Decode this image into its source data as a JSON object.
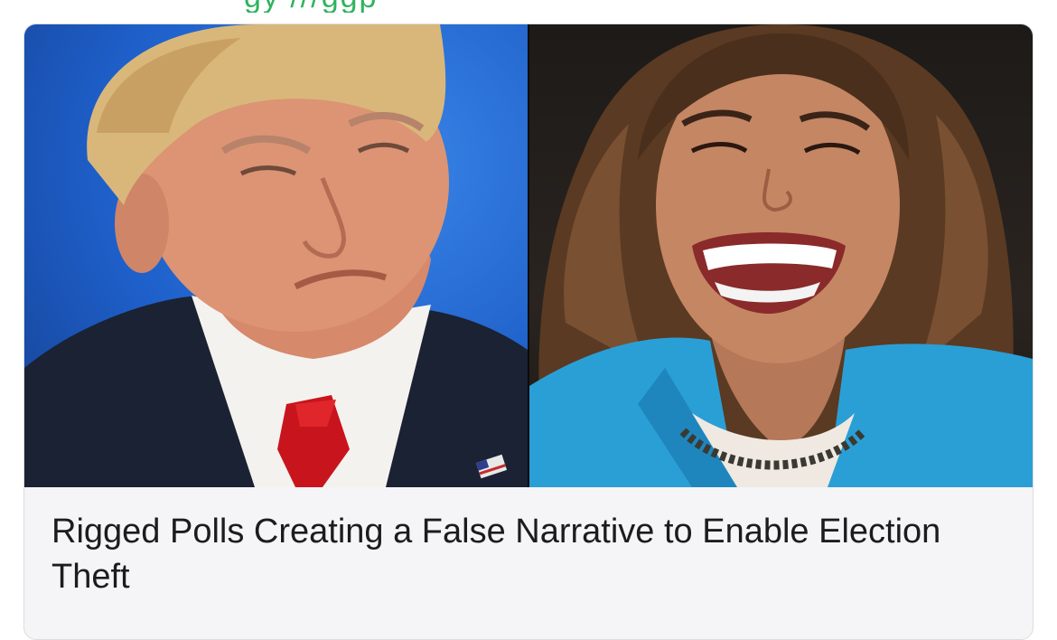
{
  "header_partial_text": "gy    ///ggp",
  "card": {
    "image_left_alt": "Man in dark suit, white shirt and red tie with flag lapel pin, blue background",
    "image_right_alt": "Smiling woman with shoulder-length brown hair in a blue jacket, dark background",
    "title": "Rigged Polls Creating a False Narrative to Enable Election Theft"
  },
  "colors": {
    "accent_green": "#2fb35e",
    "card_background": "#f5f5f7",
    "title_text": "#1c1c1e"
  }
}
